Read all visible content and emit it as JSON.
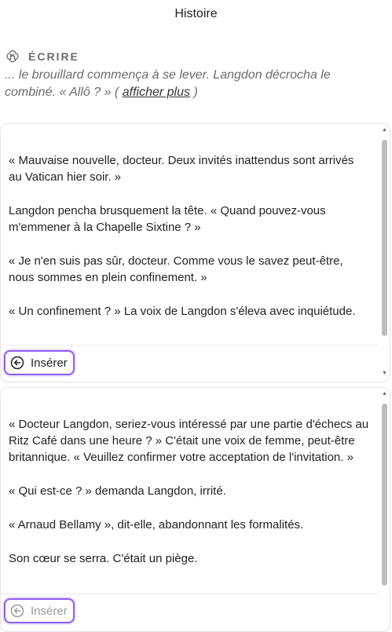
{
  "header": {
    "title": "Histoire"
  },
  "write": {
    "label": "ÉCRIRE",
    "icon": "openai-icon",
    "excerpt": "... le brouillard commença à se lever. Langdon décrocha le combiné. « Allô ? » (",
    "more": "afficher plus",
    "close_paren": " )"
  },
  "cards": [
    {
      "paragraphs": [
        "« Mauvaise nouvelle, docteur. Deux invités inattendus sont arrivés au Vatican hier soir. »",
        "Langdon pencha brusquement la tête. « Quand pouvez-vous m'emmener à la Chapelle Sixtine ? »",
        "« Je n'en suis pas sûr, docteur. Comme vous le savez peut-être, nous sommes en plein confinement. »",
        "« Un confinement ? » La voix de Langdon s'éleva avec inquiétude."
      ],
      "insert_label": "Insérer"
    },
    {
      "paragraphs": [
        "« Docteur Langdon, seriez-vous intéressé par une partie d'échecs au Ritz Café dans une heure ? » C'était une voix de femme, peut-être britannique. « Veuillez confirmer votre acceptation de l'invitation. »",
        "« Qui est-ce ? » demanda Langdon, irrité.",
        "« Arnaud Bellamy », dit-elle, abandonnant les formalités.",
        "Son cœur se serra. C'était un piège."
      ],
      "insert_label": "Insérer"
    }
  ]
}
